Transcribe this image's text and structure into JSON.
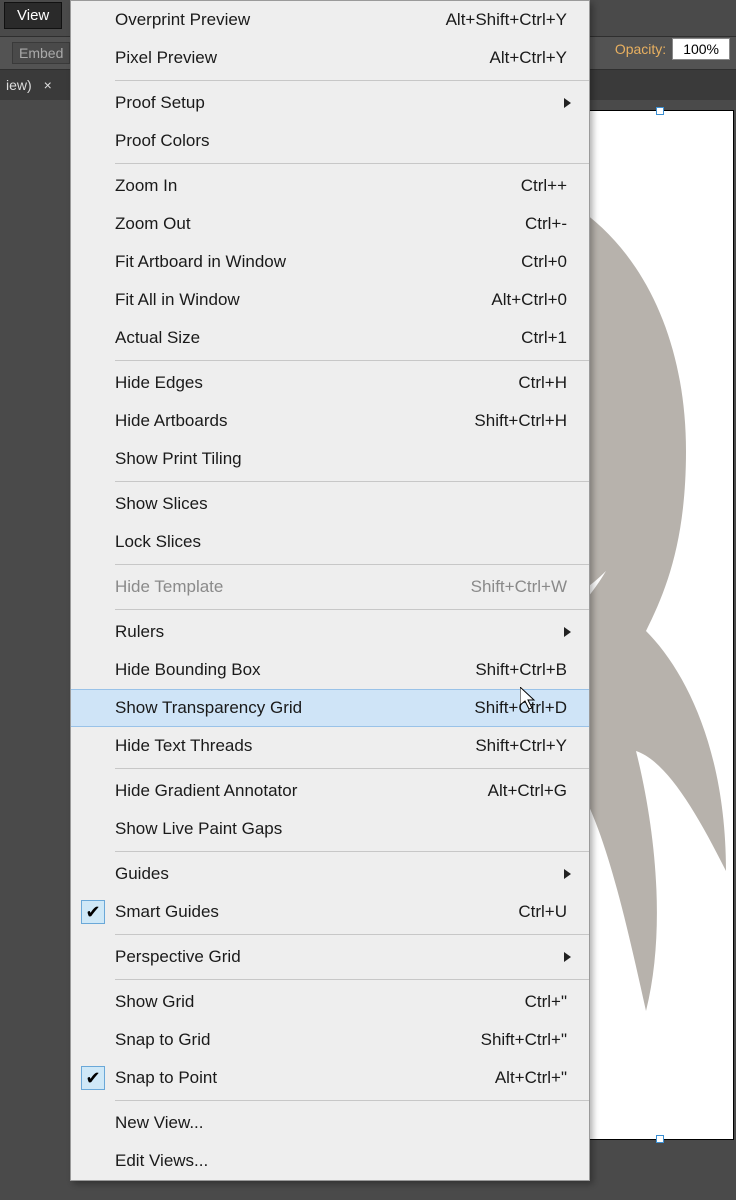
{
  "menubar": {
    "view": "View"
  },
  "toolbar": {
    "embed": "Embed",
    "tab_suffix": "iew)",
    "tab_chevron": "×"
  },
  "opacity": {
    "label": "Opacity:",
    "value": "100%"
  },
  "menu": {
    "groups": [
      [
        {
          "label": "Overprint Preview",
          "shortcut": "Alt+Shift+Ctrl+Y"
        },
        {
          "label": "Pixel Preview",
          "shortcut": "Alt+Ctrl+Y"
        }
      ],
      [
        {
          "label": "Proof Setup",
          "submenu": true
        },
        {
          "label": "Proof Colors"
        }
      ],
      [
        {
          "label": "Zoom In",
          "shortcut": "Ctrl++"
        },
        {
          "label": "Zoom Out",
          "shortcut": "Ctrl+-"
        },
        {
          "label": "Fit Artboard in Window",
          "shortcut": "Ctrl+0"
        },
        {
          "label": "Fit All in Window",
          "shortcut": "Alt+Ctrl+0"
        },
        {
          "label": "Actual Size",
          "shortcut": "Ctrl+1"
        }
      ],
      [
        {
          "label": "Hide Edges",
          "shortcut": "Ctrl+H"
        },
        {
          "label": "Hide Artboards",
          "shortcut": "Shift+Ctrl+H"
        },
        {
          "label": "Show Print Tiling"
        }
      ],
      [
        {
          "label": "Show Slices"
        },
        {
          "label": "Lock Slices"
        }
      ],
      [
        {
          "label": "Hide Template",
          "shortcut": "Shift+Ctrl+W",
          "disabled": true
        }
      ],
      [
        {
          "label": "Rulers",
          "submenu": true
        },
        {
          "label": "Hide Bounding Box",
          "shortcut": "Shift+Ctrl+B"
        },
        {
          "label": "Show Transparency Grid",
          "shortcut": "Shift+Ctrl+D",
          "highlight": true
        },
        {
          "label": "Hide Text Threads",
          "shortcut": "Shift+Ctrl+Y"
        }
      ],
      [
        {
          "label": "Hide Gradient Annotator",
          "shortcut": "Alt+Ctrl+G"
        },
        {
          "label": "Show Live Paint Gaps"
        }
      ],
      [
        {
          "label": "Guides",
          "submenu": true
        },
        {
          "label": "Smart Guides",
          "shortcut": "Ctrl+U",
          "checked": true
        }
      ],
      [
        {
          "label": "Perspective Grid",
          "submenu": true
        }
      ],
      [
        {
          "label": "Show Grid",
          "shortcut": "Ctrl+\""
        },
        {
          "label": "Snap to Grid",
          "shortcut": "Shift+Ctrl+\""
        },
        {
          "label": "Snap to Point",
          "shortcut": "Alt+Ctrl+\"",
          "checked": true
        }
      ],
      [
        {
          "label": "New View..."
        },
        {
          "label": "Edit Views..."
        }
      ]
    ]
  }
}
